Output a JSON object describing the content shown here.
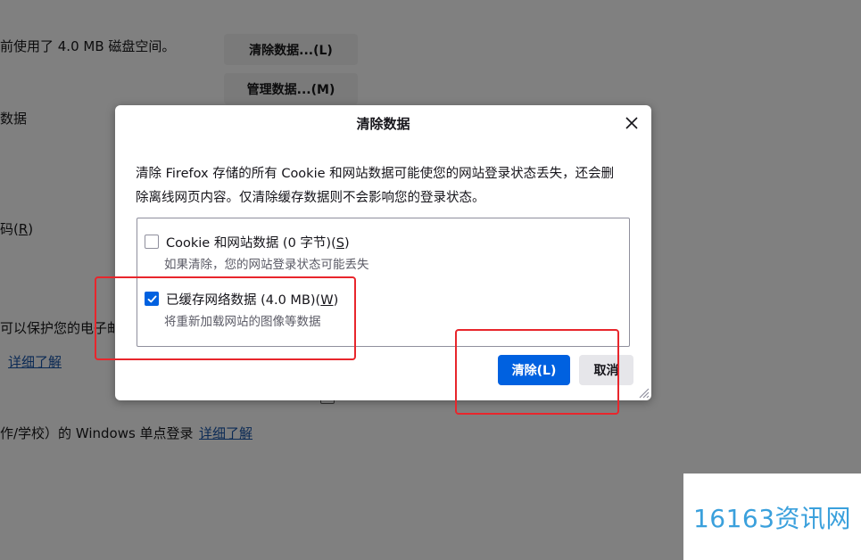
{
  "background": {
    "usage_text": "前使用了 4.0 MB 磁盘空间。",
    "clear_data_button": "清除数据...(L)",
    "manage_data_button": "管理数据...(M)",
    "row_label_data": "数据",
    "row_label_password_prefix": "码(",
    "row_label_password_key": "R",
    "row_label_password_suffix": ")",
    "row_label_email": "可以保护您的电子邮",
    "learn_more_1": "详细了解",
    "sso_text": "作/学校）的 Windows 单点登录",
    "learn_more_2": "详细了解"
  },
  "dialog": {
    "title": "清除数据",
    "description_line1": "清除 Firefox 存储的所有 Cookie 和网站数据可能使您的网站登录状态丢失，还会删",
    "description_line2": "除离线网页内容。仅清除缓存数据则不会影响您的登录状态。",
    "options": [
      {
        "label": "Cookie 和网站数据 (0 字节)(",
        "accesskey": "S",
        "label_end": ")",
        "sublabel": "如果清除，您的网站登录状态可能丢失",
        "checked": false
      },
      {
        "label": "已缓存网络数据 (4.0 MB)(",
        "accesskey": "W",
        "label_end": ")",
        "sublabel": "将重新加载网站的图像等数据",
        "checked": true
      }
    ],
    "clear_button": "清除(L)",
    "cancel_button": "取消"
  },
  "watermark": "16163资讯网",
  "colors": {
    "accent": "#0061e0",
    "annotation": "#e8262c",
    "watermark": "#3aa0dc"
  }
}
